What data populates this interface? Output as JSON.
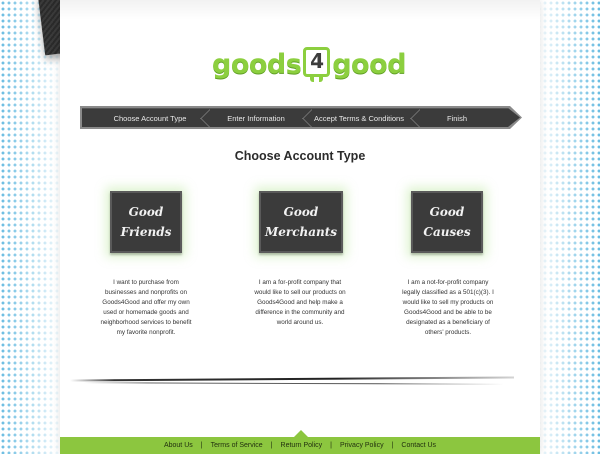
{
  "brand": {
    "logo_left": "goods",
    "logo_mid": "4",
    "logo_right": "good",
    "color_green": "#8cc63f",
    "color_dark": "#3b3b3b"
  },
  "steps": [
    "Choose Account Type",
    "Enter Information",
    "Accept Terms & Conditions",
    "Finish"
  ],
  "heading": "Choose Account Type",
  "accounts": [
    {
      "line1": "Good",
      "line2": "Friends",
      "description": "I want to purchase from businesses and nonprofits on Goods4Good and offer my own used or homemade goods and neighborhood services to benefit my favorite nonprofit."
    },
    {
      "line1": "Good",
      "line2": "Merchants",
      "description": "I am a for-profit company that would like to sell our products on Goods4Good and help make a difference in the community and world around us."
    },
    {
      "line1": "Good",
      "line2": "Causes",
      "description": "I am a not-for-profit company legally classified as a 501(c)(3). I would like to sell my products on Goods4Good and be able to be designated as a beneficiary of others' products."
    }
  ],
  "footer": {
    "links": [
      "About Us",
      "Terms of Service",
      "Return Policy",
      "Privacy Policy",
      "Contact Us"
    ],
    "separator": "|"
  }
}
